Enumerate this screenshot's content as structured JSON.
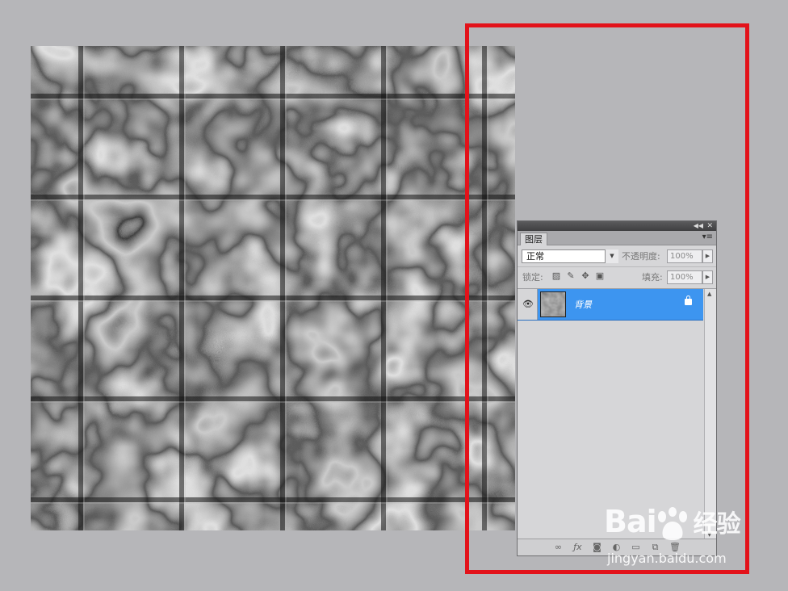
{
  "layers_panel": {
    "tab_label": "图层",
    "blend_mode": "正常",
    "opacity_label": "不透明度:",
    "opacity_value": "100%",
    "lock_label": "锁定:",
    "fill_label": "填充:",
    "fill_value": "100%",
    "layers": [
      {
        "name": "背景",
        "visible": true,
        "locked": true,
        "selected": true
      }
    ]
  },
  "watermark": {
    "brand": "Bai",
    "brand_tail": "经验",
    "url": "jingyan.baidu.com"
  },
  "colors": {
    "background": "#b6b6b9",
    "selection_blue": "#3d95f0",
    "highlight_red": "#e3121a"
  }
}
